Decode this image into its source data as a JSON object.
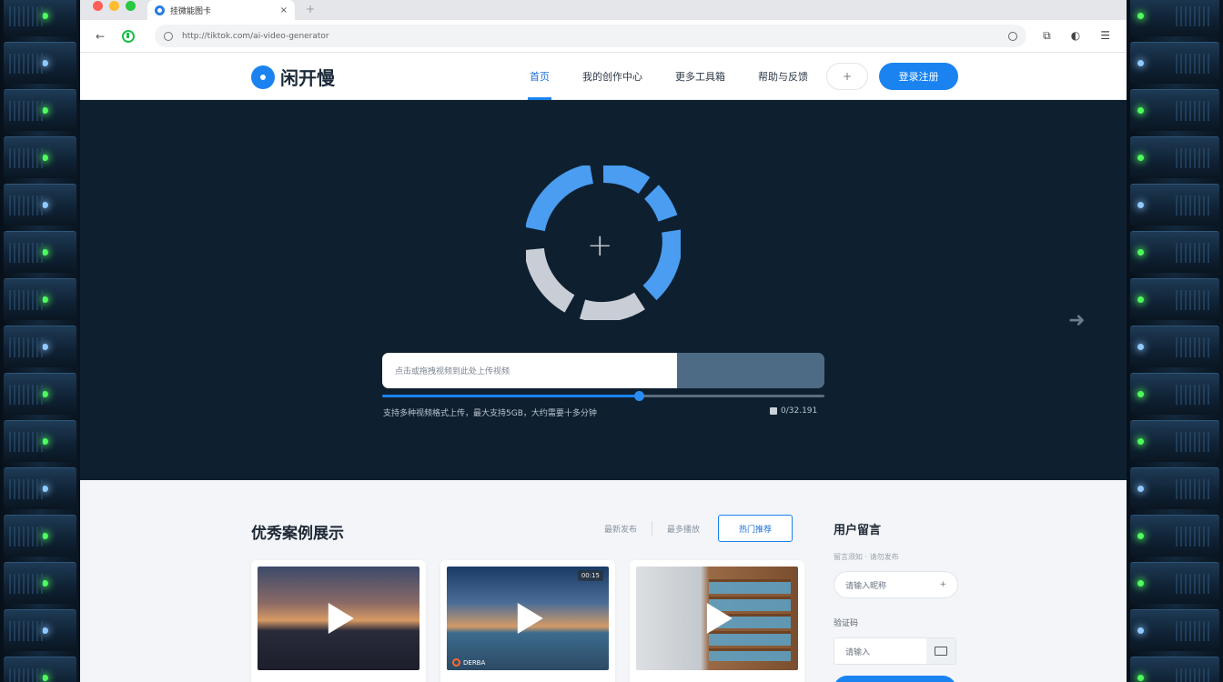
{
  "browser": {
    "tab_title": "挂微能图卡",
    "tab_close": "×",
    "new_tab": "+",
    "url": "http://tiktok.com/ai-video-generator",
    "nav_back": "←",
    "icons": [
      "shield-icon",
      "lock-icon",
      "reload-icon",
      "extensions-icon",
      "profile-icon",
      "menu-icon"
    ],
    "toolbar_icons": [
      "⧉",
      "◐",
      "☰"
    ]
  },
  "site": {
    "logo_text": "闲开慢",
    "nav": [
      {
        "label": "首页",
        "active": true
      },
      {
        "label": "我的创作中心",
        "active": false
      },
      {
        "label": "更多工具箱",
        "active": false
      },
      {
        "label": "帮助与反馈",
        "active": false
      }
    ],
    "search_icon": "+",
    "primary_button": "登录注册"
  },
  "hero": {
    "plus": "+",
    "next_arrow": "➜",
    "input_placeholder": "点击或拖拽视频到此处上传视频",
    "progress": 0.58,
    "hint": "支持多种视频格式上传，最大支持5GB，大约需要十多分钟",
    "meta": "0/32.191",
    "ring_colors": {
      "accent": "#4a9df0",
      "muted": "#c9ced6"
    }
  },
  "content": {
    "section_title": "优秀案例展示",
    "filters": [
      "最新发布",
      "最多播放"
    ],
    "filter_button": "热门推荐",
    "cards": [
      {
        "badge": "",
        "tag": ""
      },
      {
        "badge": "00:15",
        "tag": "DERBA"
      },
      {
        "badge": "",
        "tag": ""
      }
    ]
  },
  "side": {
    "title": "用户留言",
    "subtitle": "留言须知 · 请勿发布",
    "field_placeholder": "请输入昵称",
    "field_plus": "+",
    "label": "验证码",
    "field2_placeholder": "请输入"
  },
  "colors": {
    "brand": "#1a83f0",
    "hero_bg": "#0e2030"
  }
}
